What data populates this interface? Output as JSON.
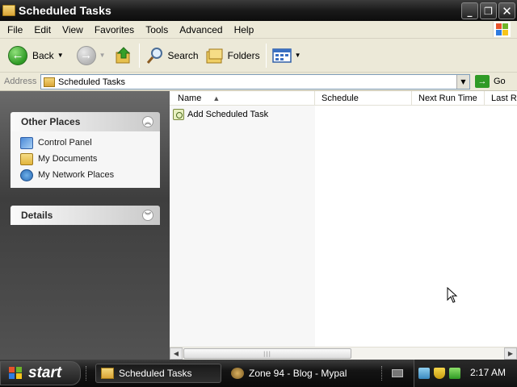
{
  "window": {
    "title": "Scheduled Tasks",
    "controls": [
      "minimize",
      "restore",
      "close"
    ]
  },
  "menu": {
    "items": [
      "File",
      "Edit",
      "View",
      "Favorites",
      "Tools",
      "Advanced",
      "Help"
    ]
  },
  "toolbar": {
    "back_label": "Back",
    "search_label": "Search",
    "folders_label": "Folders"
  },
  "address": {
    "label": "Address",
    "value": "Scheduled Tasks",
    "go_label": "Go"
  },
  "taskpane": {
    "other_places": {
      "title": "Other Places",
      "links": [
        "Control Panel",
        "My Documents",
        "My Network Places"
      ]
    },
    "details": {
      "title": "Details"
    }
  },
  "filelist": {
    "columns": [
      "Name",
      "Schedule",
      "Next Run Time",
      "Last Ru"
    ],
    "items": [
      {
        "name": "Add Scheduled Task"
      }
    ]
  },
  "taskbar": {
    "start_label": "start",
    "buttons": [
      "Scheduled Tasks",
      "Zone 94 - Blog - Mypal"
    ],
    "clock": "2:17 AM"
  },
  "colors": {
    "titlebar": "#1a1a1a",
    "menubar": "#ece9d8",
    "taskpane": "#4e4e4e",
    "accent_green": "#2f9a25"
  },
  "icons": {
    "back": "back-arrow-icon",
    "forward": "forward-arrow-icon",
    "up": "up-folder-icon",
    "search": "magnifier-icon",
    "folders": "folders-icon",
    "views": "views-icon",
    "go": "go-arrow-icon"
  }
}
